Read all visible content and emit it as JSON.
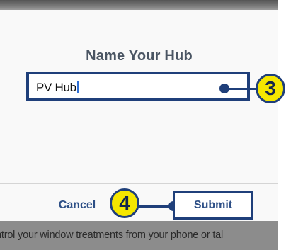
{
  "dialog": {
    "title": "Name Your Hub",
    "input_value": "PV Hub",
    "cancel_label": "Cancel",
    "submit_label": "Submit"
  },
  "callouts": {
    "input_step": "3",
    "submit_step": "4"
  },
  "background": {
    "footer_text": "ntrol your window treatments from your phone or tal"
  },
  "colors": {
    "accent": "#1f3f7a",
    "callout_fill": "#f5e600",
    "button_text": "#2d4f86",
    "caret": "#2f6fd6"
  }
}
